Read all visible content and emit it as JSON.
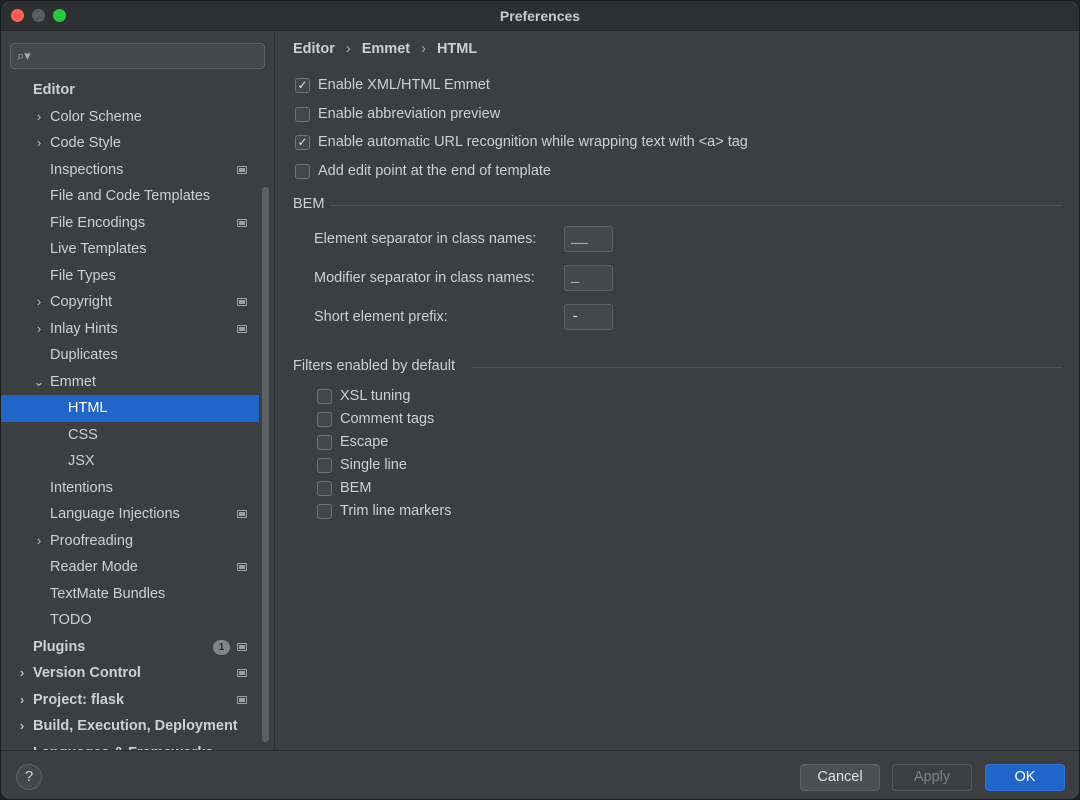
{
  "window": {
    "title": "Preferences"
  },
  "search": {
    "placeholder": ""
  },
  "sidebar": {
    "items": [
      {
        "label": "Editor",
        "level": 0,
        "bold": true,
        "chevron": "",
        "settings": false
      },
      {
        "label": "Color Scheme",
        "level": 1,
        "chevron": "›",
        "settings": false
      },
      {
        "label": "Code Style",
        "level": 1,
        "chevron": "›",
        "settings": false
      },
      {
        "label": "Inspections",
        "level": 1,
        "chevron": "",
        "settings": true
      },
      {
        "label": "File and Code Templates",
        "level": 1,
        "chevron": "",
        "settings": false
      },
      {
        "label": "File Encodings",
        "level": 1,
        "chevron": "",
        "settings": true
      },
      {
        "label": "Live Templates",
        "level": 1,
        "chevron": "",
        "settings": false
      },
      {
        "label": "File Types",
        "level": 1,
        "chevron": "",
        "settings": false
      },
      {
        "label": "Copyright",
        "level": 1,
        "chevron": "›",
        "settings": true
      },
      {
        "label": "Inlay Hints",
        "level": 1,
        "chevron": "›",
        "settings": true
      },
      {
        "label": "Duplicates",
        "level": 1,
        "chevron": "",
        "settings": false
      },
      {
        "label": "Emmet",
        "level": 1,
        "chevron": "⌄",
        "settings": false
      },
      {
        "label": "HTML",
        "level": 2,
        "chevron": "",
        "settings": false,
        "selected": true
      },
      {
        "label": "CSS",
        "level": 2,
        "chevron": "",
        "settings": false
      },
      {
        "label": "JSX",
        "level": 2,
        "chevron": "",
        "settings": false
      },
      {
        "label": "Intentions",
        "level": 1,
        "chevron": "",
        "settings": false
      },
      {
        "label": "Language Injections",
        "level": 1,
        "chevron": "",
        "settings": true
      },
      {
        "label": "Proofreading",
        "level": 1,
        "chevron": "›",
        "settings": false
      },
      {
        "label": "Reader Mode",
        "level": 1,
        "chevron": "",
        "settings": true
      },
      {
        "label": "TextMate Bundles",
        "level": 1,
        "chevron": "",
        "settings": false
      },
      {
        "label": "TODO",
        "level": 1,
        "chevron": "",
        "settings": false
      },
      {
        "label": "Plugins",
        "level": 0,
        "bold": true,
        "chevron": "",
        "settings": true,
        "badge": "1"
      },
      {
        "label": "Version Control",
        "level": 0,
        "bold": true,
        "chevron": "›",
        "settings": true
      },
      {
        "label": "Project: flask",
        "level": 0,
        "bold": true,
        "chevron": "›",
        "settings": true
      },
      {
        "label": "Build, Execution, Deployment",
        "level": 0,
        "bold": true,
        "chevron": "›",
        "settings": false
      },
      {
        "label": "Languages & Frameworks",
        "level": 0,
        "bold": true,
        "chevron": "›",
        "settings": false
      }
    ]
  },
  "breadcrumb": {
    "parts": [
      "Editor",
      "Emmet",
      "HTML"
    ]
  },
  "options": [
    {
      "label": "Enable XML/HTML Emmet",
      "checked": true
    },
    {
      "label": "Enable abbreviation preview",
      "checked": false
    },
    {
      "label": "Enable automatic URL recognition while wrapping text with <a> tag",
      "checked": true
    },
    {
      "label": "Add edit point at the end of template",
      "checked": false
    }
  ],
  "bem": {
    "heading": "BEM",
    "element_separator_label": "Element separator in class names:",
    "element_separator_value": "__",
    "modifier_separator_label": "Modifier separator in class names:",
    "modifier_separator_value": "_",
    "short_prefix_label": "Short element prefix:",
    "short_prefix_value": "-"
  },
  "filters": {
    "heading": "Filters enabled by default",
    "items": [
      {
        "label": "XSL tuning",
        "checked": false
      },
      {
        "label": "Comment tags",
        "checked": false
      },
      {
        "label": "Escape",
        "checked": false
      },
      {
        "label": "Single line",
        "checked": false
      },
      {
        "label": "BEM",
        "checked": false
      },
      {
        "label": "Trim line markers",
        "checked": false
      }
    ]
  },
  "footer": {
    "help_label": "?",
    "cancel_label": "Cancel",
    "apply_label": "Apply",
    "ok_label": "OK"
  },
  "colors": {
    "accent": "#2265c8",
    "panel": "#3c3f41",
    "titlebar": "#2d2f31"
  }
}
